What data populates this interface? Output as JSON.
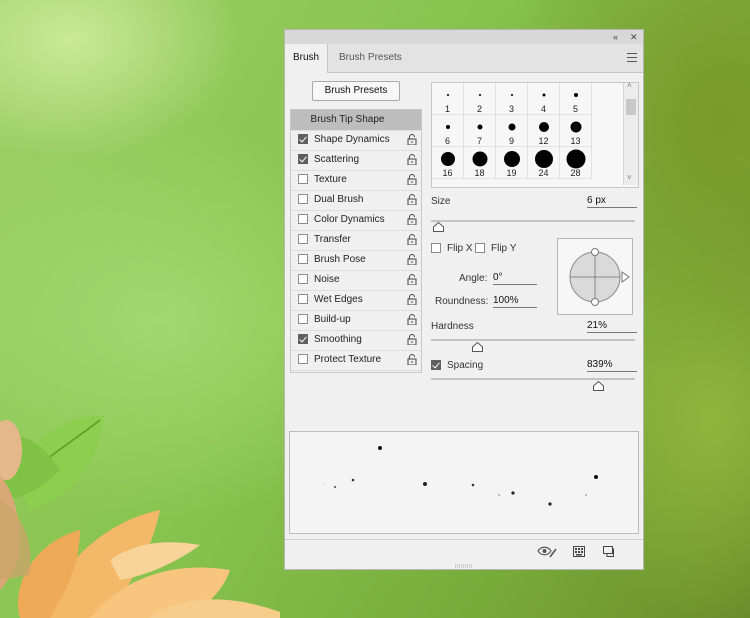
{
  "titlebar": {
    "collapse_icon": "double-chevron-left-icon",
    "close_icon": "close-icon"
  },
  "tabs": [
    {
      "label": "Brush",
      "active": true
    },
    {
      "label": "Brush Presets",
      "active": false
    }
  ],
  "panel_menu_icon": "hamburger-menu-icon",
  "brush_presets_button": "Brush Presets",
  "options": [
    {
      "label": "Brush Tip Shape",
      "header": true
    },
    {
      "label": "Shape Dynamics",
      "checked": true
    },
    {
      "label": "Scattering",
      "checked": true
    },
    {
      "label": "Texture",
      "checked": false
    },
    {
      "label": "Dual Brush",
      "checked": false
    },
    {
      "label": "Color Dynamics",
      "checked": false
    },
    {
      "label": "Transfer",
      "checked": false
    },
    {
      "label": "Brush Pose",
      "checked": false
    },
    {
      "label": "Noise",
      "checked": false
    },
    {
      "label": "Wet Edges",
      "checked": false
    },
    {
      "label": "Build-up",
      "checked": false
    },
    {
      "label": "Smoothing",
      "checked": true
    },
    {
      "label": "Protect Texture",
      "checked": false
    }
  ],
  "brush_tips": [
    {
      "size": "1"
    },
    {
      "size": "2"
    },
    {
      "size": "3"
    },
    {
      "size": "4"
    },
    {
      "size": "5"
    },
    {
      "size": "6"
    },
    {
      "size": "7"
    },
    {
      "size": "9"
    },
    {
      "size": "12"
    },
    {
      "size": "13"
    },
    {
      "size": "16"
    },
    {
      "size": "18"
    },
    {
      "size": "19"
    },
    {
      "size": "24"
    },
    {
      "size": "28"
    }
  ],
  "size": {
    "label": "Size",
    "value": "6 px"
  },
  "flip_x": {
    "label": "Flip X",
    "checked": false
  },
  "flip_y": {
    "label": "Flip Y",
    "checked": false
  },
  "angle": {
    "label": "Angle:",
    "value": "0°"
  },
  "roundness": {
    "label": "Roundness:",
    "value": "100%"
  },
  "hardness": {
    "label": "Hardness",
    "value": "21%",
    "level": 0.21
  },
  "spacing": {
    "label": "Spacing",
    "value": "839%",
    "checked": true,
    "level": 0.84
  },
  "size_level": 0.01,
  "bottom_icons": [
    "eye-brush-icon",
    "keyboard-icon",
    "new-preset-icon"
  ]
}
